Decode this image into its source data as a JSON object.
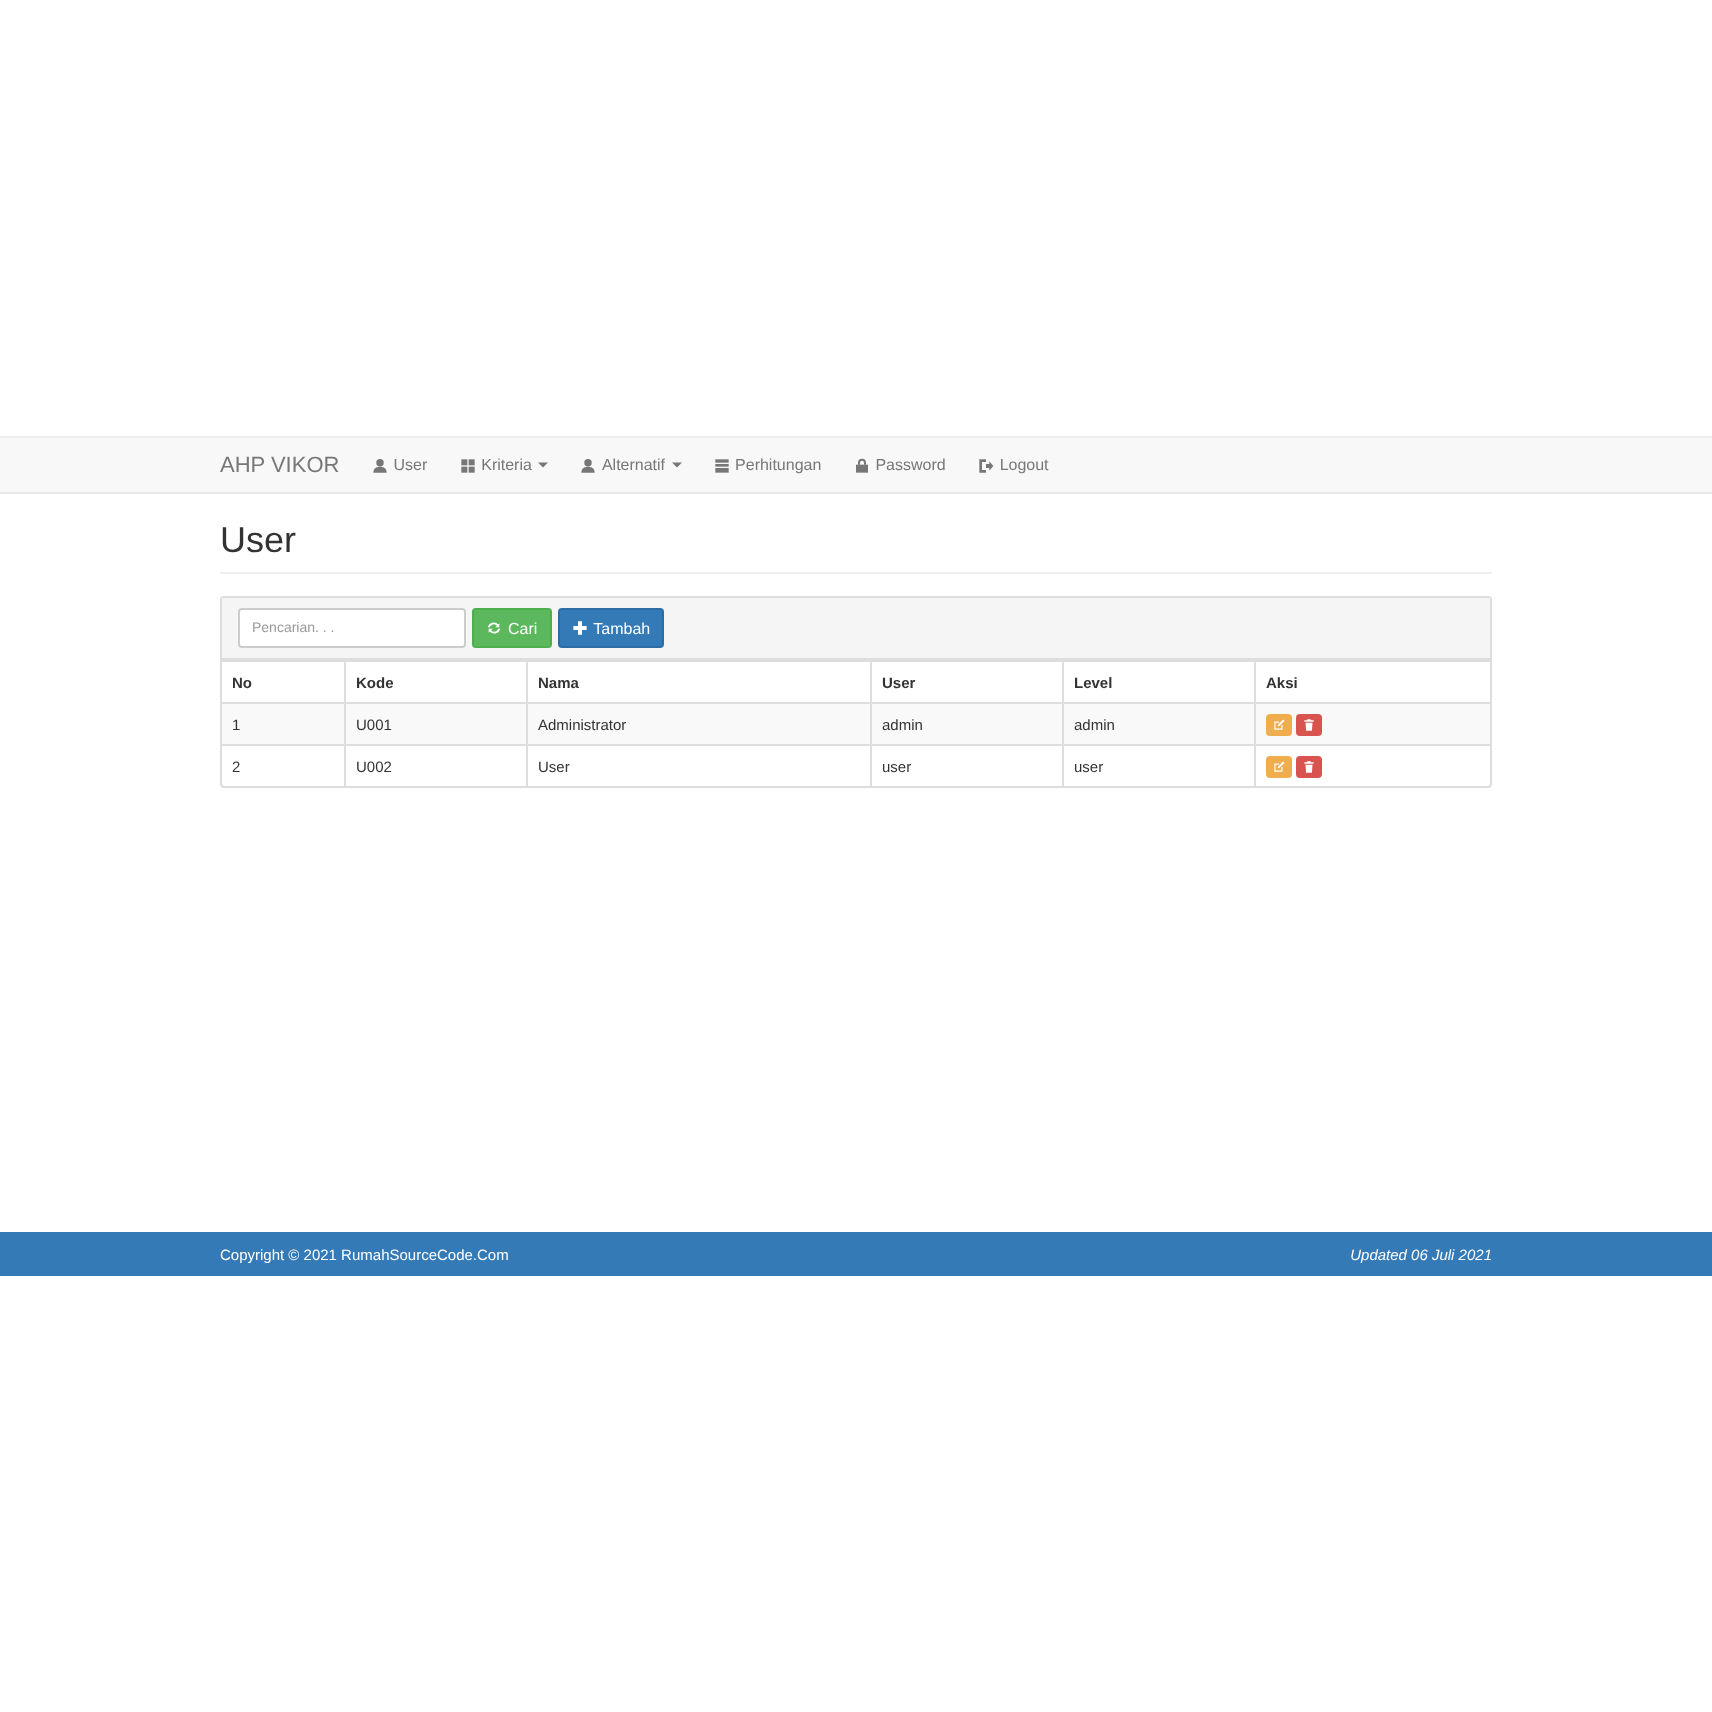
{
  "navbar": {
    "brand": "AHP VIKOR",
    "items": [
      {
        "label": "User",
        "dropdown": false
      },
      {
        "label": "Kriteria",
        "dropdown": true
      },
      {
        "label": "Alternatif",
        "dropdown": true
      },
      {
        "label": "Perhitungan",
        "dropdown": false
      },
      {
        "label": "Password",
        "dropdown": false
      },
      {
        "label": "Logout",
        "dropdown": false
      }
    ]
  },
  "page_title": "User",
  "toolbar": {
    "search": {
      "placeholder": "Pencarian. . ."
    },
    "buttons": [
      {
        "label": "Cari",
        "kind": "search"
      },
      {
        "label": "Tambah",
        "kind": "add"
      }
    ]
  },
  "table": {
    "columns": [
      "No",
      "Kode",
      "Nama",
      "User",
      "Level",
      "Aksi"
    ],
    "rows": [
      [
        "1",
        "U001",
        "Administrator",
        "admin",
        "admin"
      ],
      [
        "2",
        "U002",
        "User",
        "user",
        "user"
      ]
    ]
  },
  "footer": {
    "copyright": "Copyright © 2021 RumahSourceCode.Com",
    "updated": "Updated 06 Juli 2021"
  }
}
